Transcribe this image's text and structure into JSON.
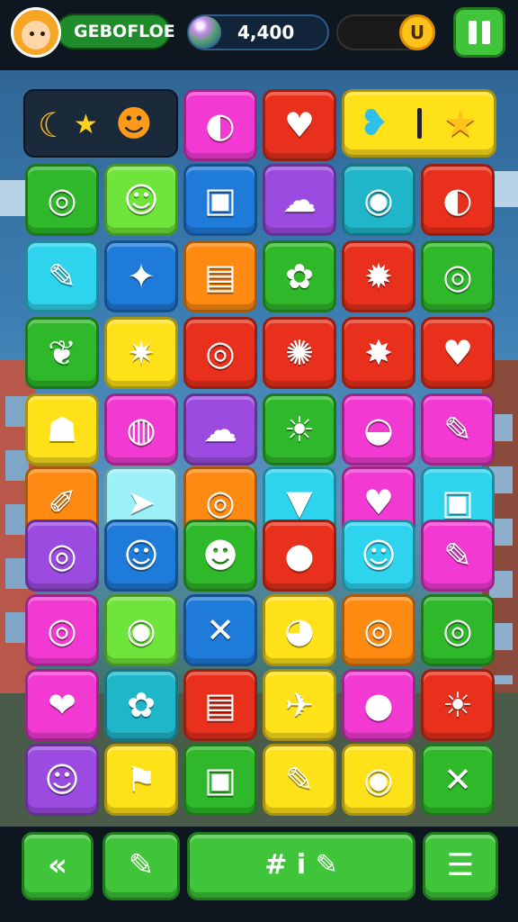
{
  "header": {
    "player_name": "GEBOFLOE",
    "score": "4,400",
    "coin_symbol": "U",
    "pause_icon": "pause-icon"
  },
  "board": {
    "colors": {
      "green": "#2fb82a",
      "lime": "#6fe43a",
      "blue": "#1f7bd9",
      "purple": "#9b4be0",
      "teal": "#1fb6c9",
      "orange": "#ff8a12",
      "red": "#e8301c",
      "yellow": "#ffe11a",
      "cyan": "#2ed4ee",
      "magenta": "#f23ad3",
      "pink": "#ff4aa5",
      "pale": "#9cf0f8"
    },
    "tiles": [
      {
        "color": "magenta",
        "icon": "◐"
      },
      {
        "color": "red",
        "icon": "♥"
      },
      {
        "color": "green",
        "icon": "◎"
      },
      {
        "color": "lime",
        "icon": "☺"
      },
      {
        "color": "blue",
        "icon": "▣"
      },
      {
        "color": "purple",
        "icon": "☁"
      },
      {
        "color": "teal",
        "icon": "◉"
      },
      {
        "color": "red",
        "icon": "◐"
      },
      {
        "color": "cyan",
        "icon": "✎"
      },
      {
        "color": "blue",
        "icon": "✦"
      },
      {
        "color": "orange",
        "icon": "▤"
      },
      {
        "color": "green",
        "icon": "✿"
      },
      {
        "color": "red",
        "icon": "✹"
      },
      {
        "color": "green",
        "icon": "◎"
      },
      {
        "color": "green",
        "icon": "❦"
      },
      {
        "color": "yellow",
        "icon": "✷"
      },
      {
        "color": "red",
        "icon": "◎"
      },
      {
        "color": "red",
        "icon": "✺"
      },
      {
        "color": "red",
        "icon": "✸"
      },
      {
        "color": "red",
        "icon": "♥"
      },
      {
        "color": "yellow",
        "icon": "☗"
      },
      {
        "color": "magenta",
        "icon": "◍"
      },
      {
        "color": "purple",
        "icon": "☁"
      },
      {
        "color": "green",
        "icon": "☀"
      },
      {
        "color": "magenta",
        "icon": "◒"
      },
      {
        "color": "magenta",
        "icon": "✎"
      },
      {
        "color": "orange",
        "icon": "✐"
      },
      {
        "color": "pale",
        "icon": "➤"
      },
      {
        "color": "orange",
        "icon": "◎"
      },
      {
        "color": "cyan",
        "icon": "▼"
      },
      {
        "color": "magenta",
        "icon": "♥"
      },
      {
        "color": "cyan",
        "icon": "▣"
      },
      {
        "color": "purple",
        "icon": "◎"
      },
      {
        "color": "blue",
        "icon": "☺"
      },
      {
        "color": "green",
        "icon": "☻"
      },
      {
        "color": "red",
        "icon": "●"
      },
      {
        "color": "cyan",
        "icon": "☺"
      },
      {
        "color": "magenta",
        "icon": "✎"
      },
      {
        "color": "magenta",
        "icon": "◎"
      },
      {
        "color": "lime",
        "icon": "◉"
      },
      {
        "color": "blue",
        "icon": "✕"
      },
      {
        "color": "yellow",
        "icon": "◕"
      },
      {
        "color": "orange",
        "icon": "◎"
      },
      {
        "color": "green",
        "icon": "◎"
      },
      {
        "color": "magenta",
        "icon": "❤"
      },
      {
        "color": "teal",
        "icon": "✿"
      },
      {
        "color": "red",
        "icon": "▤"
      },
      {
        "color": "yellow",
        "icon": "✈"
      },
      {
        "color": "magenta",
        "icon": "●"
      },
      {
        "color": "red",
        "icon": "☀"
      },
      {
        "color": "purple",
        "icon": "☺"
      },
      {
        "color": "yellow",
        "icon": "⚑"
      },
      {
        "color": "green",
        "icon": "▣"
      },
      {
        "color": "yellow",
        "icon": "✎"
      },
      {
        "color": "yellow",
        "icon": "◉"
      },
      {
        "color": "green",
        "icon": "✕"
      }
    ]
  },
  "toolbar": {
    "buttons": [
      {
        "name": "back-button",
        "label": "«"
      },
      {
        "name": "pencil-button",
        "label": "✎"
      },
      {
        "name": "hint-button",
        "label": "# i ✎"
      },
      {
        "name": "menu-button",
        "label": "☰"
      }
    ]
  }
}
